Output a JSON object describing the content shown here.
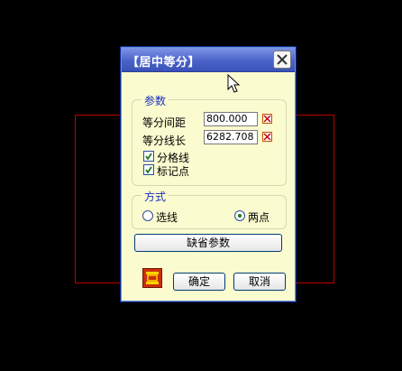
{
  "dialog": {
    "title": "【居中等分】"
  },
  "params_group": {
    "legend": "参数",
    "spacing_label": "等分间距",
    "spacing_value": "800.000",
    "length_label": "等分线长",
    "length_value": "6282.708",
    "divider_label": "分格线",
    "divider_checked": true,
    "mark_label": "标记点",
    "mark_checked": true
  },
  "mode_group": {
    "legend": "方式",
    "option_line": "选线",
    "option_twopoint": "两点",
    "selected": "两点"
  },
  "buttons": {
    "default_params": "缺省参数",
    "ok": "确定",
    "cancel": "取消"
  },
  "colors": {
    "title_bar": "#4a63c8",
    "dialog_bg": "#fbfbd0",
    "group_legend": "#1a30c0",
    "background_rect": "#c00000"
  }
}
